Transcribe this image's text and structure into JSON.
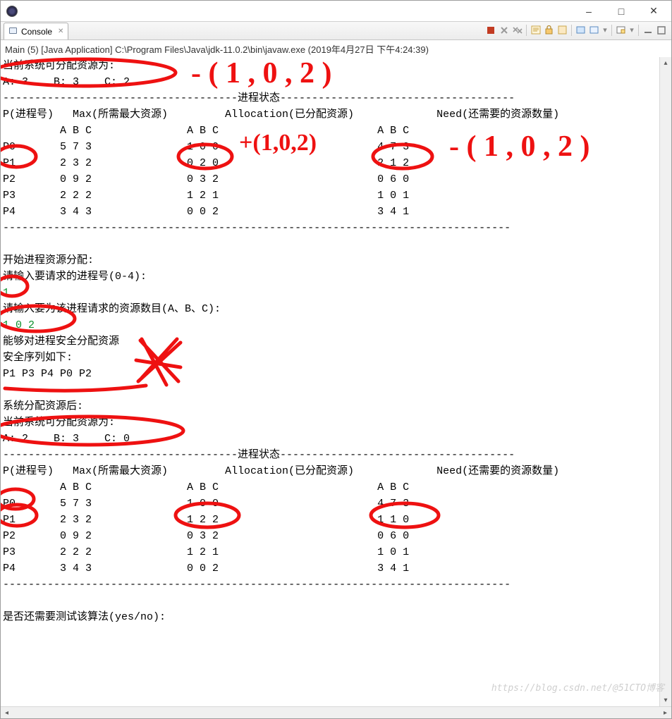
{
  "window": {
    "title": ""
  },
  "tab": {
    "label": "Console"
  },
  "launch": {
    "text": "Main (5) [Java Application] C:\\Program Files\\Java\\jdk-11.0.2\\bin\\javaw.exe (2019年4月27日 下午4:24:39)"
  },
  "annotations": {
    "top_minus": "- ( 1 , 0 , 2 )",
    "plus_alloc": "+(1,0,2)",
    "minus_need": "- ( 1 , 0 , 2 )"
  },
  "console": {
    "current_avail_label": "当前系统可分配资源为:",
    "avail1": {
      "A": 3,
      "B": 3,
      "C": 2
    },
    "state_header": "进程状态",
    "cols": {
      "p": "P(进程号)",
      "max": "Max(所需最大资源)",
      "alloc": "Allocation(已分配资源)",
      "need": "Need(还需要的资源数量)",
      "abc": "A B C"
    },
    "table1": [
      {
        "p": "P0",
        "max": [
          5,
          7,
          3
        ],
        "alloc": [
          1,
          0,
          0
        ],
        "need": [
          4,
          7,
          3
        ]
      },
      {
        "p": "P1",
        "max": [
          2,
          3,
          2
        ],
        "alloc": [
          0,
          2,
          0
        ],
        "need": [
          2,
          1,
          2
        ]
      },
      {
        "p": "P2",
        "max": [
          0,
          9,
          2
        ],
        "alloc": [
          0,
          3,
          2
        ],
        "need": [
          0,
          6,
          0
        ]
      },
      {
        "p": "P3",
        "max": [
          2,
          2,
          2
        ],
        "alloc": [
          1,
          2,
          1
        ],
        "need": [
          1,
          0,
          1
        ]
      },
      {
        "p": "P4",
        "max": [
          3,
          4,
          3
        ],
        "alloc": [
          0,
          0,
          2
        ],
        "need": [
          3,
          4,
          1
        ]
      }
    ],
    "start_label": "开始进程资源分配:",
    "prompt_proc": "请输入要请求的进程号(0-4):",
    "input_proc": "1",
    "prompt_res": "请输入要为该进程请求的资源数目(A、B、C):",
    "input_res": "1 0 2",
    "safe_msg": "能够对进程安全分配资源",
    "seq_label": "安全序列如下:",
    "seq": "P1 P3 P4 P0 P2",
    "after_label": "系统分配资源后:",
    "current_avail_label2": "当前系统可分配资源为:",
    "avail2": {
      "A": 2,
      "B": 3,
      "C": 0
    },
    "table2": [
      {
        "p": "P0",
        "max": [
          5,
          7,
          3
        ],
        "alloc": [
          1,
          0,
          0
        ],
        "need": [
          4,
          7,
          3
        ]
      },
      {
        "p": "P1",
        "max": [
          2,
          3,
          2
        ],
        "alloc": [
          1,
          2,
          2
        ],
        "need": [
          1,
          1,
          0
        ]
      },
      {
        "p": "P2",
        "max": [
          0,
          9,
          2
        ],
        "alloc": [
          0,
          3,
          2
        ],
        "need": [
          0,
          6,
          0
        ]
      },
      {
        "p": "P3",
        "max": [
          2,
          2,
          2
        ],
        "alloc": [
          1,
          2,
          1
        ],
        "need": [
          1,
          0,
          1
        ]
      },
      {
        "p": "P4",
        "max": [
          3,
          4,
          3
        ],
        "alloc": [
          0,
          0,
          2
        ],
        "need": [
          3,
          4,
          1
        ]
      }
    ],
    "again_prompt": "是否还需要测试该算法(yes/no):"
  },
  "watermark": "https://blog.csdn.net/@51CTO博客"
}
